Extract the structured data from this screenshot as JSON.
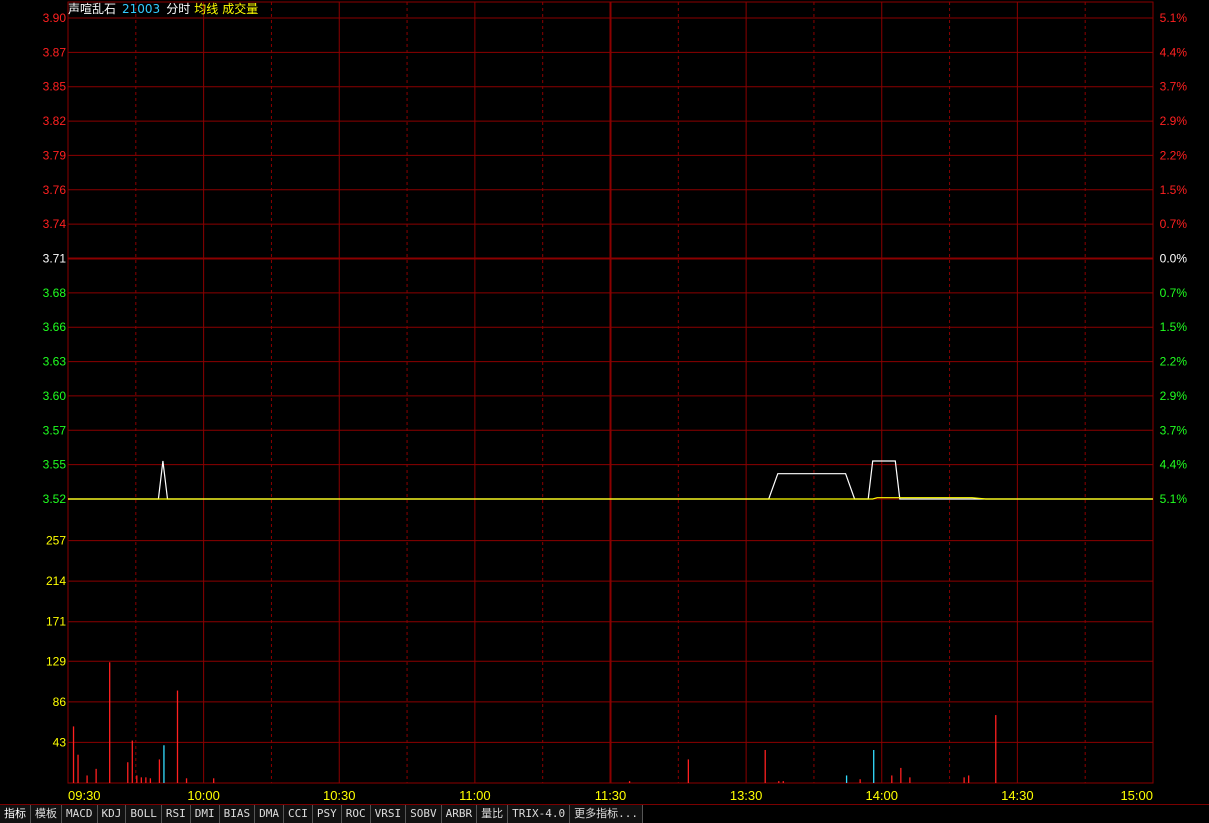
{
  "header": {
    "stock_name": "声喧乱石",
    "code": "21003",
    "item1": "分时",
    "item2": "均线",
    "item3": "成交量"
  },
  "colors": {
    "background": "#000000",
    "grid": "#8b0000",
    "up": "#ff2020",
    "down": "#20ff20",
    "flat": "#ffffff",
    "volume_axis": "#ffff00",
    "price_line": "#ffffff",
    "avg_line": "#ffff00",
    "time_label": "#ffff00"
  },
  "chart_data": [
    {
      "type": "line",
      "name": "intraday-price",
      "ylim": [
        3.52,
        3.9
      ],
      "prev_close": 3.71,
      "left_ticks": [
        "3.90",
        "3.87",
        "3.85",
        "3.82",
        "3.79",
        "3.76",
        "3.74",
        "3.71",
        "3.68",
        "3.66",
        "3.63",
        "3.60",
        "3.57",
        "3.55",
        "3.52"
      ],
      "right_ticks": [
        "5.1%",
        "4.4%",
        "3.7%",
        "2.9%",
        "2.2%",
        "1.5%",
        "0.7%",
        "0.0%",
        "0.7%",
        "1.5%",
        "2.2%",
        "2.9%",
        "3.7%",
        "4.4%",
        "5.1%"
      ],
      "x_ticks": [
        "09:30",
        "10:00",
        "10:30",
        "11:00",
        "11:30",
        "13:30",
        "14:00",
        "14:30",
        "15:00"
      ],
      "series": [
        {
          "points": [
            [
              0,
              3.52
            ],
            [
              20,
              3.52
            ],
            [
              21,
              3.55
            ],
            [
              22,
              3.52
            ],
            [
              155,
              3.52
            ],
            [
              157,
              3.54
            ],
            [
              172,
              3.54
            ],
            [
              174,
              3.52
            ],
            [
              177,
              3.52
            ],
            [
              178,
              3.55
            ],
            [
              183,
              3.55
            ],
            [
              184,
              3.52
            ],
            [
              240,
              3.52
            ]
          ]
        },
        {
          "points": [
            [
              0,
              3.52
            ],
            [
              178,
              3.52
            ],
            [
              179,
              3.521
            ],
            [
              200,
              3.521
            ],
            [
              203,
              3.52
            ],
            [
              240,
              3.52
            ]
          ]
        }
      ]
    },
    {
      "type": "bar",
      "name": "volume",
      "ylim": [
        0,
        300
      ],
      "left_ticks": [
        "257",
        "214",
        "171",
        "129",
        "86",
        "43"
      ],
      "bars": [
        [
          1,
          60,
          "up"
        ],
        [
          2,
          30,
          "up"
        ],
        [
          4,
          8,
          "up"
        ],
        [
          6,
          15,
          "up"
        ],
        [
          9,
          128,
          "up"
        ],
        [
          13,
          22,
          "up"
        ],
        [
          14,
          45,
          "up"
        ],
        [
          15,
          8,
          "up"
        ],
        [
          16,
          6,
          "up"
        ],
        [
          17,
          6,
          "up"
        ],
        [
          18,
          5,
          "up"
        ],
        [
          20,
          25,
          "up"
        ],
        [
          21,
          40,
          "down"
        ],
        [
          24,
          98,
          "up"
        ],
        [
          26,
          5,
          "up"
        ],
        [
          32,
          5,
          "up"
        ],
        [
          124,
          2,
          "up"
        ],
        [
          137,
          25,
          "up"
        ],
        [
          154,
          35,
          "up"
        ],
        [
          157,
          2,
          "up"
        ],
        [
          158,
          2,
          "up"
        ],
        [
          172,
          8,
          "down"
        ],
        [
          175,
          4,
          "up"
        ],
        [
          178,
          35,
          "down"
        ],
        [
          182,
          8,
          "up"
        ],
        [
          184,
          16,
          "up"
        ],
        [
          186,
          6,
          "up"
        ],
        [
          198,
          6,
          "up"
        ],
        [
          199,
          8,
          "up"
        ],
        [
          205,
          72,
          "up"
        ]
      ]
    }
  ],
  "tabs": [
    "指标",
    "模板",
    "MACD",
    "KDJ",
    "BOLL",
    "RSI",
    "DMI",
    "BIAS",
    "DMA",
    "CCI",
    "PSY",
    "ROC",
    "VRSI",
    "SOBV",
    "ARBR",
    "量比",
    "TRIX-4.0",
    "更多指标..."
  ]
}
